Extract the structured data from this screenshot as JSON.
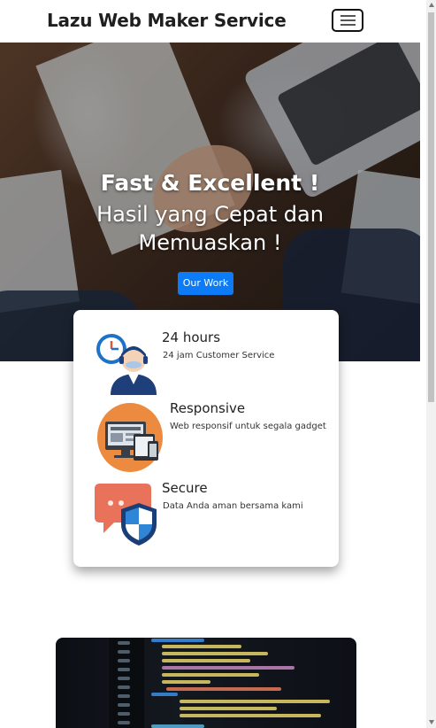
{
  "navbar": {
    "brand": "Lazu Web Maker Service",
    "toggler_icon": "hamburger-menu-icon"
  },
  "hero": {
    "title": "Fast & Excellent !",
    "subtitle": "Hasil yang Cepat dan Memuaskan !",
    "button_label": "Our Work"
  },
  "features": [
    {
      "icon": "customer-service-clock-icon",
      "title": "24 hours",
      "desc": "24 jam Customer Service"
    },
    {
      "icon": "responsive-devices-icon",
      "title": "Responsive",
      "desc": "Web responsif untuk segala gadget"
    },
    {
      "icon": "secure-shield-chat-icon",
      "title": "Secure",
      "desc": "Data Anda aman bersama kami"
    }
  ],
  "colors": {
    "primary_button": "#0d7bf5",
    "text_dark": "#222222"
  }
}
